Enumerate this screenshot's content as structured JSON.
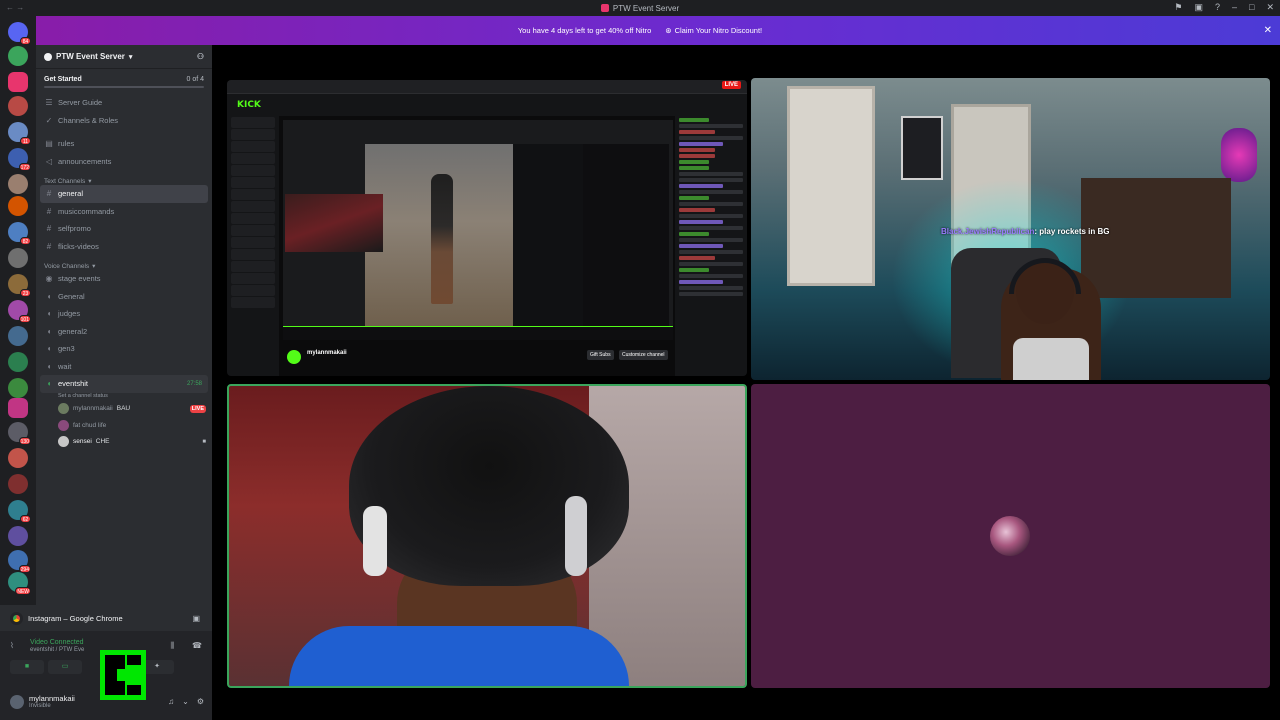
{
  "titlebar": {
    "title": "PTW Event Server"
  },
  "banner": {
    "text": "You have 4 days left to get 40% off Nitro",
    "cta": "Claim Your Nitro Discount!"
  },
  "guild_badges": [
    "84",
    "11",
    "172",
    "82",
    "23",
    "101",
    "130",
    "62",
    "294",
    "NEW"
  ],
  "server": {
    "name": "PTW Event Server",
    "get_started": {
      "label": "Get Started",
      "count": "0 of 4"
    },
    "items": [
      {
        "icon": "📋",
        "label": "Server Guide"
      },
      {
        "icon": "✔",
        "label": "Channels & Roles"
      }
    ],
    "top_channels": [
      "rules",
      "announcements"
    ],
    "text_category": "Text Channels",
    "text_channels": [
      "general",
      "musiccommands",
      "selfpromo",
      "flicks-videos"
    ],
    "voice_category": "Voice Channels",
    "voice_channels": [
      "stage events",
      "General",
      "judges",
      "general2",
      "gen3",
      "wait"
    ],
    "active_voice": {
      "name": "eventshit",
      "time": "27:58",
      "status": "Set a channel status"
    },
    "voice_users": [
      {
        "name": "mylannmakaii",
        "tag": "BAU",
        "live": "LIVE"
      },
      {
        "name": "fat chud life",
        "tag": ""
      },
      {
        "name": "sensei",
        "tag": "CHE"
      }
    ]
  },
  "activity": {
    "label": "Instagram – Google Chrome"
  },
  "voice_connection": {
    "label": "Video Connected",
    "sub": "eventshit / PTW Eve"
  },
  "user": {
    "name": "mylannmakaii",
    "status": "Invisible"
  },
  "stream": {
    "site": "KICK",
    "live": "LIVE",
    "streamer": "mylannmakaii",
    "gift_subs": "Gift Subs",
    "customize": "Customize channel"
  },
  "cam1": {
    "overlay_user": "Black.JewishRepublican",
    "overlay_text": ": play rockets in BG"
  }
}
